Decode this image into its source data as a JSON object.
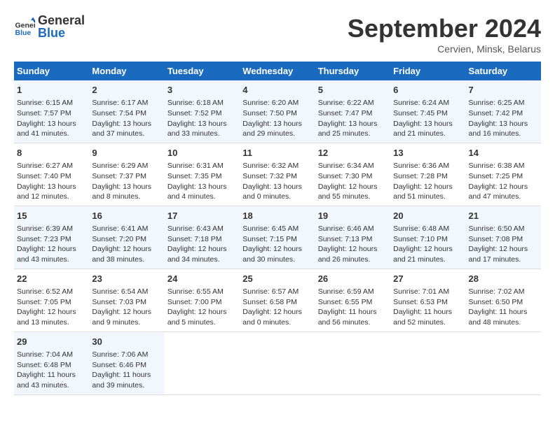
{
  "header": {
    "title": "September 2024",
    "location": "Cervien, Minsk, Belarus",
    "logo_general": "General",
    "logo_blue": "Blue"
  },
  "columns": [
    "Sunday",
    "Monday",
    "Tuesday",
    "Wednesday",
    "Thursday",
    "Friday",
    "Saturday"
  ],
  "rows": [
    [
      {
        "day": "1",
        "line1": "Sunrise: 6:15 AM",
        "line2": "Sunset: 7:57 PM",
        "line3": "Daylight: 13 hours",
        "line4": "and 41 minutes."
      },
      {
        "day": "2",
        "line1": "Sunrise: 6:17 AM",
        "line2": "Sunset: 7:54 PM",
        "line3": "Daylight: 13 hours",
        "line4": "and 37 minutes."
      },
      {
        "day": "3",
        "line1": "Sunrise: 6:18 AM",
        "line2": "Sunset: 7:52 PM",
        "line3": "Daylight: 13 hours",
        "line4": "and 33 minutes."
      },
      {
        "day": "4",
        "line1": "Sunrise: 6:20 AM",
        "line2": "Sunset: 7:50 PM",
        "line3": "Daylight: 13 hours",
        "line4": "and 29 minutes."
      },
      {
        "day": "5",
        "line1": "Sunrise: 6:22 AM",
        "line2": "Sunset: 7:47 PM",
        "line3": "Daylight: 13 hours",
        "line4": "and 25 minutes."
      },
      {
        "day": "6",
        "line1": "Sunrise: 6:24 AM",
        "line2": "Sunset: 7:45 PM",
        "line3": "Daylight: 13 hours",
        "line4": "and 21 minutes."
      },
      {
        "day": "7",
        "line1": "Sunrise: 6:25 AM",
        "line2": "Sunset: 7:42 PM",
        "line3": "Daylight: 13 hours",
        "line4": "and 16 minutes."
      }
    ],
    [
      {
        "day": "8",
        "line1": "Sunrise: 6:27 AM",
        "line2": "Sunset: 7:40 PM",
        "line3": "Daylight: 13 hours",
        "line4": "and 12 minutes."
      },
      {
        "day": "9",
        "line1": "Sunrise: 6:29 AM",
        "line2": "Sunset: 7:37 PM",
        "line3": "Daylight: 13 hours",
        "line4": "and 8 minutes."
      },
      {
        "day": "10",
        "line1": "Sunrise: 6:31 AM",
        "line2": "Sunset: 7:35 PM",
        "line3": "Daylight: 13 hours",
        "line4": "and 4 minutes."
      },
      {
        "day": "11",
        "line1": "Sunrise: 6:32 AM",
        "line2": "Sunset: 7:32 PM",
        "line3": "Daylight: 13 hours",
        "line4": "and 0 minutes."
      },
      {
        "day": "12",
        "line1": "Sunrise: 6:34 AM",
        "line2": "Sunset: 7:30 PM",
        "line3": "Daylight: 12 hours",
        "line4": "and 55 minutes."
      },
      {
        "day": "13",
        "line1": "Sunrise: 6:36 AM",
        "line2": "Sunset: 7:28 PM",
        "line3": "Daylight: 12 hours",
        "line4": "and 51 minutes."
      },
      {
        "day": "14",
        "line1": "Sunrise: 6:38 AM",
        "line2": "Sunset: 7:25 PM",
        "line3": "Daylight: 12 hours",
        "line4": "and 47 minutes."
      }
    ],
    [
      {
        "day": "15",
        "line1": "Sunrise: 6:39 AM",
        "line2": "Sunset: 7:23 PM",
        "line3": "Daylight: 12 hours",
        "line4": "and 43 minutes."
      },
      {
        "day": "16",
        "line1": "Sunrise: 6:41 AM",
        "line2": "Sunset: 7:20 PM",
        "line3": "Daylight: 12 hours",
        "line4": "and 38 minutes."
      },
      {
        "day": "17",
        "line1": "Sunrise: 6:43 AM",
        "line2": "Sunset: 7:18 PM",
        "line3": "Daylight: 12 hours",
        "line4": "and 34 minutes."
      },
      {
        "day": "18",
        "line1": "Sunrise: 6:45 AM",
        "line2": "Sunset: 7:15 PM",
        "line3": "Daylight: 12 hours",
        "line4": "and 30 minutes."
      },
      {
        "day": "19",
        "line1": "Sunrise: 6:46 AM",
        "line2": "Sunset: 7:13 PM",
        "line3": "Daylight: 12 hours",
        "line4": "and 26 minutes."
      },
      {
        "day": "20",
        "line1": "Sunrise: 6:48 AM",
        "line2": "Sunset: 7:10 PM",
        "line3": "Daylight: 12 hours",
        "line4": "and 21 minutes."
      },
      {
        "day": "21",
        "line1": "Sunrise: 6:50 AM",
        "line2": "Sunset: 7:08 PM",
        "line3": "Daylight: 12 hours",
        "line4": "and 17 minutes."
      }
    ],
    [
      {
        "day": "22",
        "line1": "Sunrise: 6:52 AM",
        "line2": "Sunset: 7:05 PM",
        "line3": "Daylight: 12 hours",
        "line4": "and 13 minutes."
      },
      {
        "day": "23",
        "line1": "Sunrise: 6:54 AM",
        "line2": "Sunset: 7:03 PM",
        "line3": "Daylight: 12 hours",
        "line4": "and 9 minutes."
      },
      {
        "day": "24",
        "line1": "Sunrise: 6:55 AM",
        "line2": "Sunset: 7:00 PM",
        "line3": "Daylight: 12 hours",
        "line4": "and 5 minutes."
      },
      {
        "day": "25",
        "line1": "Sunrise: 6:57 AM",
        "line2": "Sunset: 6:58 PM",
        "line3": "Daylight: 12 hours",
        "line4": "and 0 minutes."
      },
      {
        "day": "26",
        "line1": "Sunrise: 6:59 AM",
        "line2": "Sunset: 6:55 PM",
        "line3": "Daylight: 11 hours",
        "line4": "and 56 minutes."
      },
      {
        "day": "27",
        "line1": "Sunrise: 7:01 AM",
        "line2": "Sunset: 6:53 PM",
        "line3": "Daylight: 11 hours",
        "line4": "and 52 minutes."
      },
      {
        "day": "28",
        "line1": "Sunrise: 7:02 AM",
        "line2": "Sunset: 6:50 PM",
        "line3": "Daylight: 11 hours",
        "line4": "and 48 minutes."
      }
    ],
    [
      {
        "day": "29",
        "line1": "Sunrise: 7:04 AM",
        "line2": "Sunset: 6:48 PM",
        "line3": "Daylight: 11 hours",
        "line4": "and 43 minutes."
      },
      {
        "day": "30",
        "line1": "Sunrise: 7:06 AM",
        "line2": "Sunset: 6:46 PM",
        "line3": "Daylight: 11 hours",
        "line4": "and 39 minutes."
      },
      {
        "day": "",
        "line1": "",
        "line2": "",
        "line3": "",
        "line4": ""
      },
      {
        "day": "",
        "line1": "",
        "line2": "",
        "line3": "",
        "line4": ""
      },
      {
        "day": "",
        "line1": "",
        "line2": "",
        "line3": "",
        "line4": ""
      },
      {
        "day": "",
        "line1": "",
        "line2": "",
        "line3": "",
        "line4": ""
      },
      {
        "day": "",
        "line1": "",
        "line2": "",
        "line3": "",
        "line4": ""
      }
    ]
  ]
}
